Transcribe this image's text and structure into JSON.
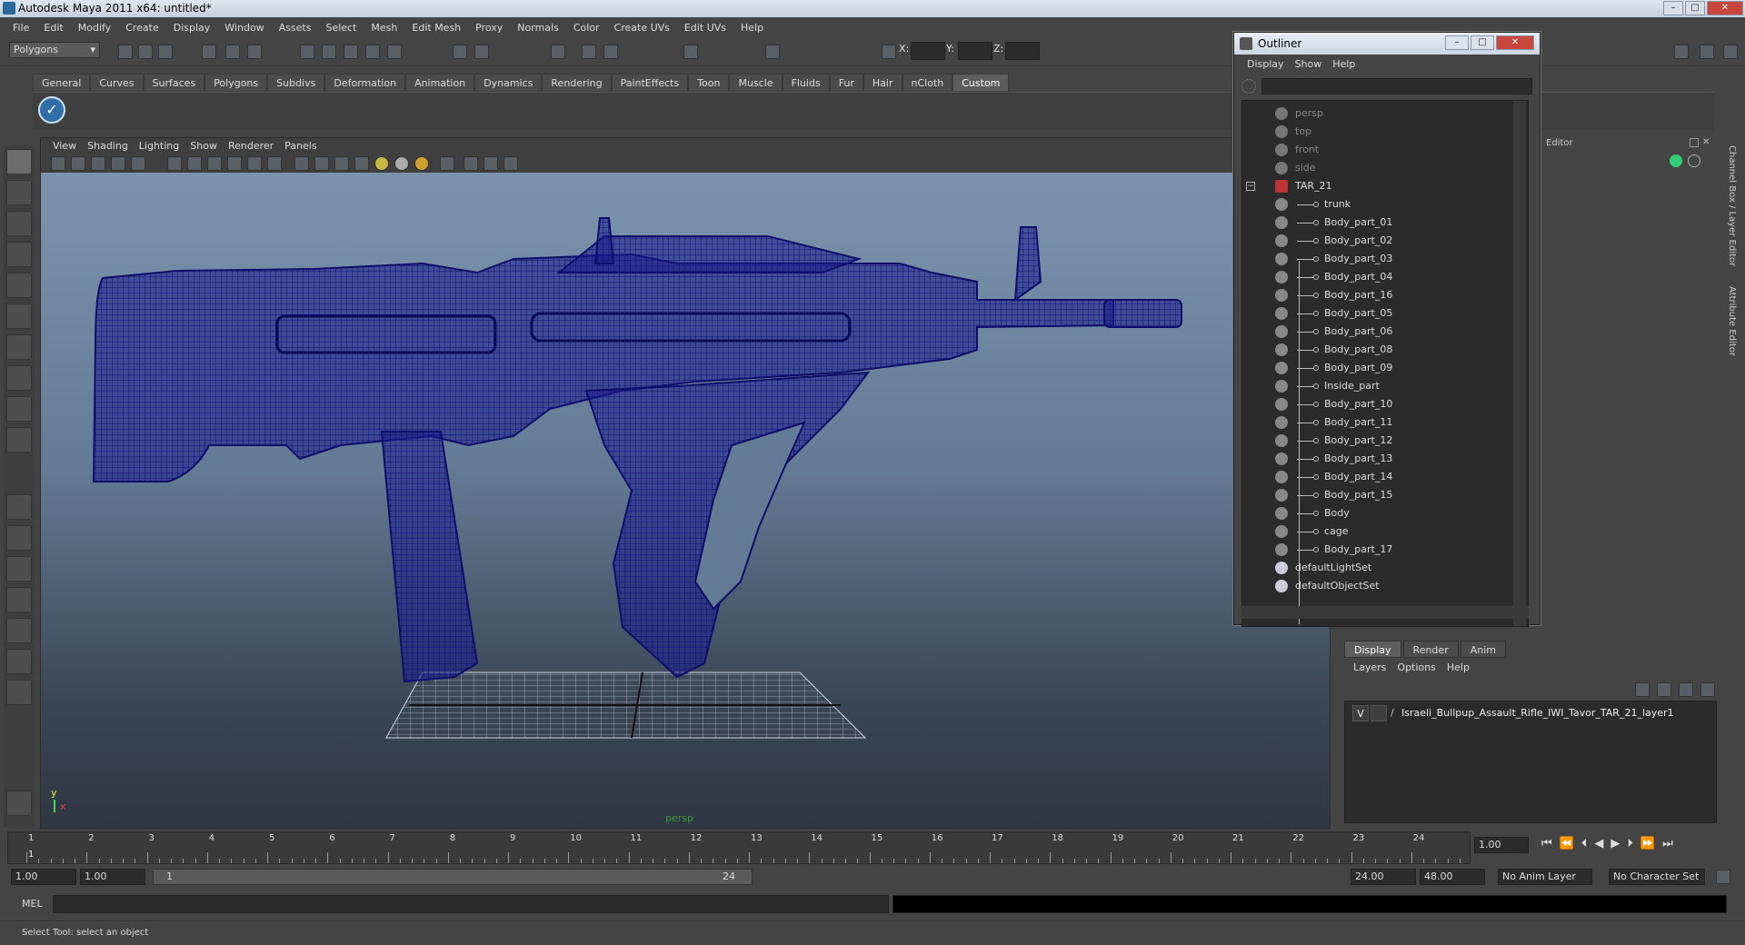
{
  "window": {
    "title": "Autodesk Maya 2011 x64: untitled*"
  },
  "menubar": [
    "File",
    "Edit",
    "Modify",
    "Create",
    "Display",
    "Window",
    "Assets",
    "Select",
    "Mesh",
    "Edit Mesh",
    "Proxy",
    "Normals",
    "Color",
    "Create UVs",
    "Edit UVs",
    "Help"
  ],
  "statusline": {
    "mode": "Polygons",
    "x_label": "X:",
    "y_label": "Y:",
    "z_label": "Z:"
  },
  "shelf": {
    "tabs": [
      "General",
      "Curves",
      "Surfaces",
      "Polygons",
      "Subdivs",
      "Deformation",
      "Animation",
      "Dynamics",
      "Rendering",
      "PaintEffects",
      "Toon",
      "Muscle",
      "Fluids",
      "Fur",
      "Hair",
      "nCloth",
      "Custom"
    ],
    "active": "Custom"
  },
  "viewport": {
    "menu": [
      "View",
      "Shading",
      "Lighting",
      "Show",
      "Renderer",
      "Panels"
    ],
    "camera_label": "persp",
    "axis": {
      "y": "y",
      "x": "x"
    },
    "model_color": "#14147a"
  },
  "outliner": {
    "title": "Outliner",
    "menu": [
      "Display",
      "Show",
      "Help"
    ],
    "items": [
      {
        "label": "persp",
        "kind": "camera"
      },
      {
        "label": "top",
        "kind": "camera"
      },
      {
        "label": "front",
        "kind": "camera"
      },
      {
        "label": "side",
        "kind": "camera"
      },
      {
        "label": "TAR_21",
        "kind": "group"
      },
      {
        "label": "trunk",
        "kind": "child"
      },
      {
        "label": "Body_part_01",
        "kind": "child"
      },
      {
        "label": "Body_part_02",
        "kind": "child"
      },
      {
        "label": "Body_part_03",
        "kind": "child"
      },
      {
        "label": "Body_part_04",
        "kind": "child"
      },
      {
        "label": "Body_part_16",
        "kind": "child"
      },
      {
        "label": "Body_part_05",
        "kind": "child"
      },
      {
        "label": "Body_part_06",
        "kind": "child"
      },
      {
        "label": "Body_part_08",
        "kind": "child"
      },
      {
        "label": "Body_part_09",
        "kind": "child"
      },
      {
        "label": "Inside_part",
        "kind": "child"
      },
      {
        "label": "Body_part_10",
        "kind": "child"
      },
      {
        "label": "Body_part_11",
        "kind": "child"
      },
      {
        "label": "Body_part_12",
        "kind": "child"
      },
      {
        "label": "Body_part_13",
        "kind": "child"
      },
      {
        "label": "Body_part_14",
        "kind": "child"
      },
      {
        "label": "Body_part_15",
        "kind": "child"
      },
      {
        "label": "Body",
        "kind": "child"
      },
      {
        "label": "cage",
        "kind": "child"
      },
      {
        "label": "Body_part_17",
        "kind": "child"
      },
      {
        "label": "defaultLightSet",
        "kind": "set"
      },
      {
        "label": "defaultObjectSet",
        "kind": "set"
      }
    ]
  },
  "side_tabs": [
    "Channel Box / Layer Editor",
    "Attribute Editor"
  ],
  "channel_box": {
    "editor_label": "Editor"
  },
  "layer_editor": {
    "tabs": [
      "Display",
      "Render",
      "Anim"
    ],
    "active_tab": "Display",
    "menu": [
      "Layers",
      "Options",
      "Help"
    ],
    "layer": {
      "visible": "V",
      "name": "Israeli_Bullpup_Assault_Rifle_IWI_Tavor_TAR_21_layer1"
    }
  },
  "timeline": {
    "ticks": [
      "1",
      "2",
      "3",
      "4",
      "5",
      "6",
      "7",
      "8",
      "9",
      "10",
      "11",
      "12",
      "13",
      "14",
      "15",
      "16",
      "17",
      "18",
      "19",
      "20",
      "21",
      "22",
      "23",
      "24"
    ],
    "current_marker": "1",
    "current_frame": "1.00"
  },
  "range": {
    "start": "1.00",
    "anim_start": "1.00",
    "slider_start": "1",
    "slider_end": "24",
    "end": "24.00",
    "anim_end": "48.00",
    "anim_layer": "No Anim Layer",
    "character_set": "No Character Set"
  },
  "command": {
    "label": "MEL"
  },
  "help_line": "Select Tool: select an object"
}
